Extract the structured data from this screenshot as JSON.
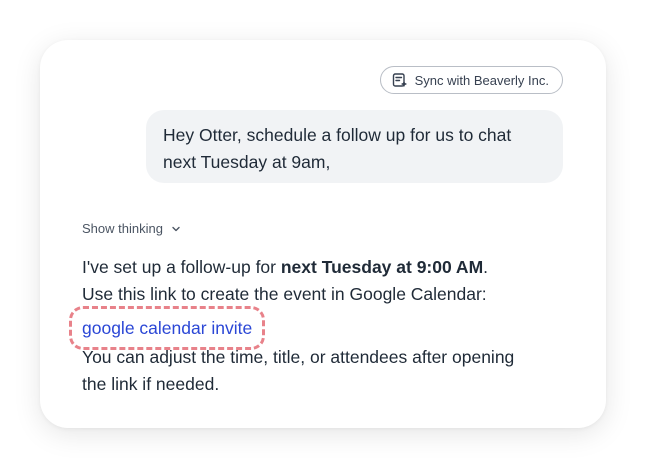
{
  "header": {
    "sync_label": "Sync with Beaverly Inc."
  },
  "user_message": {
    "line1": "Hey Otter, schedule a follow up for us to chat",
    "line2": "next Tuesday at 9am,"
  },
  "thinking": {
    "label": "Show thinking"
  },
  "assistant_message": {
    "line1_prefix": "I've set up a follow-up for ",
    "line1_bold": "next Tuesday at 9:00 AM",
    "line1_suffix": ".",
    "line2": "Use this link to create the event in Google Calendar:",
    "link_text": "google calendar invite",
    "line3": "You can adjust the time, title, or attendees after opening",
    "line4": "the link if needed."
  },
  "colors": {
    "link": "#2b47d6",
    "highlight_dashes": "#e8828a",
    "bubble_bg": "#f1f3f5"
  }
}
